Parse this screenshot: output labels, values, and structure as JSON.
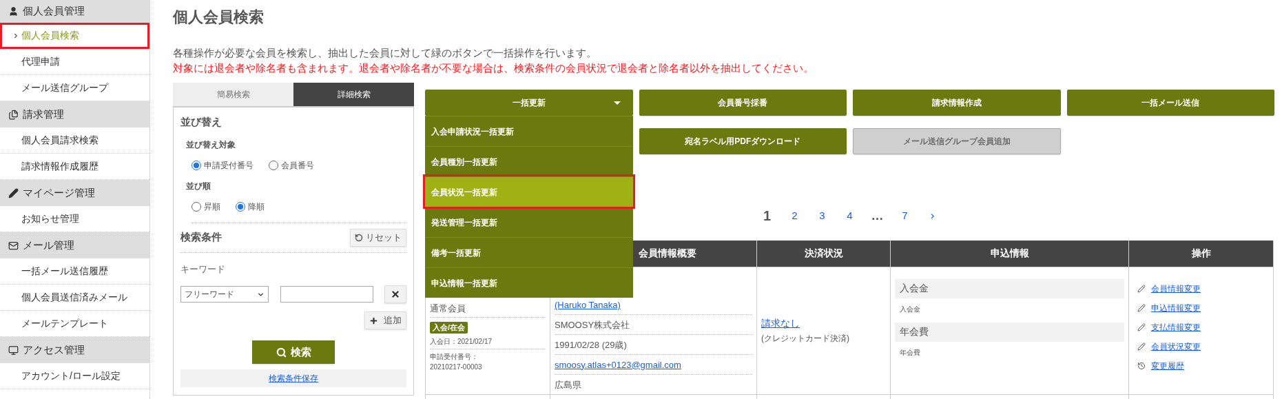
{
  "sidebar": {
    "sections": [
      {
        "title": "個人会員管理",
        "kind": "person",
        "items": [
          {
            "label": "個人会員検索",
            "selected": true,
            "annotated": true
          },
          {
            "label": "代理申請",
            "selected": false,
            "annotated": false
          },
          {
            "label": "メール送信グループ",
            "selected": false,
            "annotated": false
          }
        ]
      },
      {
        "title": "請求管理",
        "kind": "documents",
        "items": [
          {
            "label": "個人会員請求検索",
            "selected": false,
            "annotated": false
          },
          {
            "label": "請求情報作成履歴",
            "selected": false,
            "annotated": false
          }
        ]
      },
      {
        "title": "マイページ管理",
        "kind": "pencil",
        "items": [
          {
            "label": "お知らせ管理",
            "selected": false,
            "annotated": false
          }
        ]
      },
      {
        "title": "メール管理",
        "kind": "mail",
        "items": [
          {
            "label": "一括メール送信履歴",
            "selected": false,
            "annotated": false
          },
          {
            "label": "個人会員送信済みメール",
            "selected": false,
            "annotated": false
          },
          {
            "label": "メールテンプレート",
            "selected": false,
            "annotated": false
          }
        ]
      },
      {
        "title": "アクセス管理",
        "kind": "monitor",
        "items": [
          {
            "label": "アカウント/ロール設定",
            "selected": false,
            "annotated": false
          }
        ]
      }
    ]
  },
  "page": {
    "title": "個人会員検索",
    "description": "各種操作が必要な会員を検索し、抽出した会員に対して緑のボタンで一括操作を行います。",
    "warning": "対象には退会者や除名者も含まれます。退会者や除名者が不要な場合は、検索条件の会員状況で退会者と除名者以外を抽出してください。"
  },
  "search_panel": {
    "tabs": [
      {
        "label": "簡易検索",
        "selected": false
      },
      {
        "label": "詳細検索",
        "selected": true
      }
    ],
    "sort": {
      "heading": "並び替え",
      "target_label": "並び替え対象",
      "target_options": [
        {
          "label": "申請受付番号",
          "selected": true
        },
        {
          "label": "会員番号",
          "selected": false
        }
      ],
      "order_label": "並び順",
      "order_options": [
        {
          "label": "昇順",
          "selected": false
        },
        {
          "label": "降順",
          "selected": true
        }
      ]
    },
    "conditions": {
      "heading": "検索条件",
      "reset_button": "リセット",
      "keyword_label": "キーワード",
      "keyword_select": "フリーワード",
      "add_button": "追加"
    },
    "search_button": "検索",
    "save_link": "検索条件保存"
  },
  "actions": {
    "buttons": [
      {
        "label": "一括更新",
        "kind": "dropdown",
        "disabled": false
      },
      {
        "label": "会員番号採番",
        "kind": "button",
        "disabled": false
      },
      {
        "label": "請求情報作成",
        "kind": "button",
        "disabled": false
      },
      {
        "label": "一括メール送信",
        "kind": "button",
        "disabled": false
      },
      {
        "label": "宛名ラベル用PDFダウンロード",
        "kind": "button",
        "disabled": false
      },
      {
        "label": "メール送信グループ会員追加",
        "kind": "button",
        "disabled": true
      }
    ],
    "dropdown_items": [
      {
        "label": "入会申請状況一括更新",
        "selected": false,
        "annotated": false
      },
      {
        "label": "会員種別一括更新",
        "selected": false,
        "annotated": false
      },
      {
        "label": "会員状況一括更新",
        "selected": true,
        "annotated": true
      },
      {
        "label": "発送管理一括更新",
        "selected": false,
        "annotated": false
      },
      {
        "label": "備考一括更新",
        "selected": false,
        "annotated": false
      },
      {
        "label": "申込情報一括更新",
        "selected": false,
        "annotated": false
      }
    ]
  },
  "pagination": [
    {
      "label": "1",
      "kind": "page",
      "selected": true
    },
    {
      "label": "2",
      "kind": "page",
      "selected": false
    },
    {
      "label": "3",
      "kind": "page",
      "selected": false
    },
    {
      "label": "4",
      "kind": "page",
      "selected": false
    },
    {
      "label": "…",
      "kind": "ellipsis"
    },
    {
      "label": "7",
      "kind": "page",
      "selected": false
    },
    {
      "label": "›",
      "kind": "next"
    }
  ],
  "table": {
    "columns": [
      "会員情報概要",
      "決済状況",
      "申込情報",
      "操作"
    ],
    "rows": [
      {
        "member": {
          "type": "通常会員",
          "status_badge": "入会/在会",
          "joined": "入会日：2021/02/17",
          "application_label": "申請受付番号：",
          "application_no": "20210217-00003"
        },
        "summary": [
          {
            "text": "(Haruko Tanaka)",
            "kind": "link"
          },
          {
            "text": "SMOOSY株式会社",
            "kind": "text"
          },
          {
            "text": "1991/02/28 (29歳)",
            "kind": "text"
          },
          {
            "text": "smoosy.atlas+0123@gmail.com",
            "kind": "link"
          },
          {
            "text": "広島県",
            "kind": "text"
          }
        ],
        "payment": {
          "link": "請求なし",
          "note": "(クレジットカード決済)"
        },
        "application": [
          {
            "title": "入会金",
            "detail": "入会金"
          },
          {
            "title": "年会費",
            "detail": "年会費"
          }
        ],
        "operations": [
          {
            "label": "会員情報変更",
            "kind": "edit"
          },
          {
            "label": "申込情報変更",
            "kind": "edit"
          },
          {
            "label": "支払情報変更",
            "kind": "edit"
          },
          {
            "label": "会員状況変更",
            "kind": "edit"
          },
          {
            "label": "変更履歴",
            "kind": "history"
          }
        ]
      }
    ]
  }
}
